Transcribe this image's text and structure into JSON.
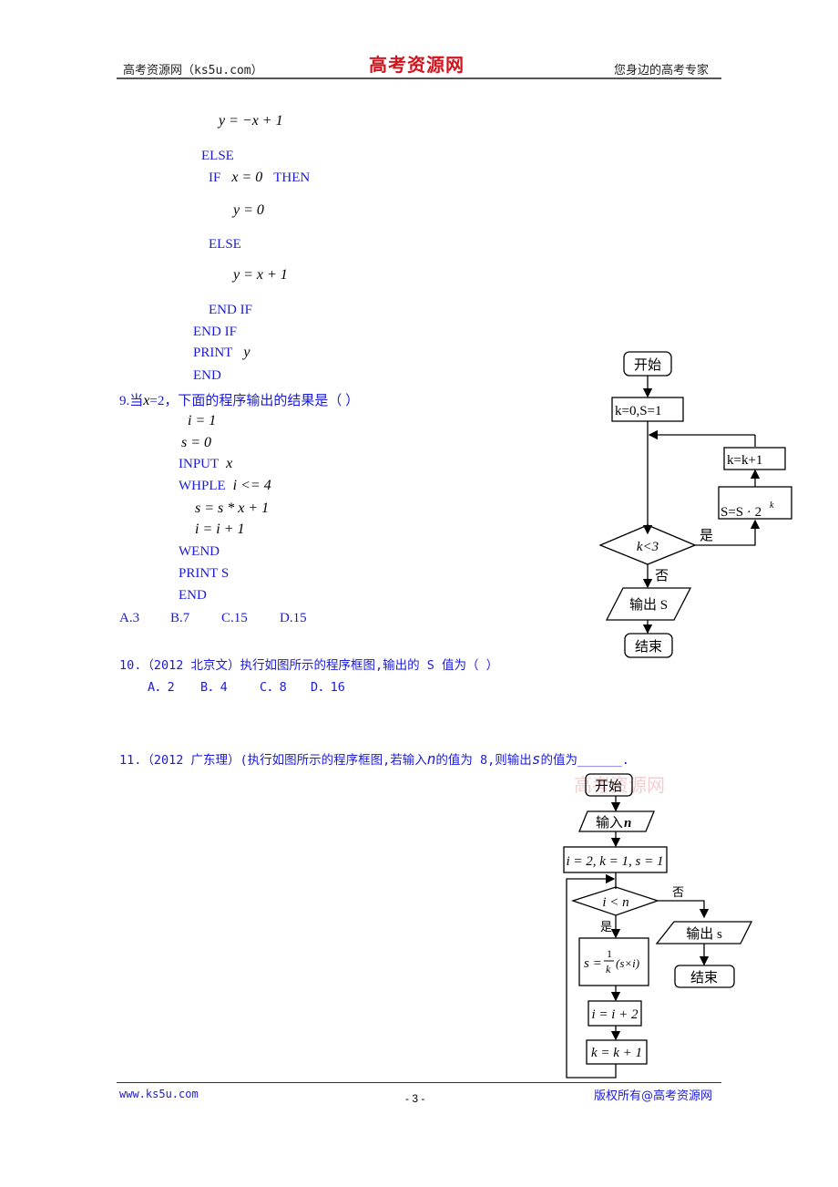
{
  "header": {
    "left": "高考资源网（ks5u.com）",
    "center_logo": "高考资源网",
    "right": "您身边的高考专家"
  },
  "program8": {
    "lines": [
      {
        "type": "math",
        "text": "y = −x + 1"
      },
      {
        "type": "kw",
        "text": "ELSE"
      },
      {
        "type": "mixed",
        "kw1": "IF",
        "math": "x = 0",
        "kw2": "THEN"
      },
      {
        "type": "math",
        "text": "y = 0"
      },
      {
        "type": "kw",
        "text": "ELSE"
      },
      {
        "type": "math",
        "text": "y = x + 1"
      },
      {
        "type": "kw",
        "text": "END IF"
      },
      {
        "type": "kw",
        "text": "END IF"
      },
      {
        "type": "mixed",
        "kw1": "PRINT",
        "math": "y"
      },
      {
        "type": "kw",
        "text": "END"
      }
    ]
  },
  "question9": {
    "stem_prefix": "9.当",
    "stem_var": "x",
    "stem_suffix": "=2，下面的程序输出的结果是（  ）",
    "code": {
      "l1": "i = 1",
      "l2": "s = 0",
      "l3_kw": "INPUT",
      "l3_var": "x",
      "l4_kw": "WHPLE",
      "l4_cond": "i <= 4",
      "l5": "s = s * x + 1",
      "l6": "i = i + 1",
      "l7": "WEND",
      "l8": "PRINT S",
      "l9": "END"
    },
    "options": [
      "A.3",
      "B.7",
      "C.15",
      "D.15"
    ]
  },
  "question10": {
    "stem": "10.（2012 北京文）执行如图所示的程序框图,输出的 S 值为（        ）",
    "options": [
      "A．2",
      "B．4",
      "C．8",
      "D．16"
    ],
    "flowchart": {
      "start": "开始",
      "init": "k=0,S=1",
      "cond": "k<3",
      "yes": "是",
      "no": "否",
      "update_s": "S=S · 2",
      "update_s_exp": "k",
      "update_k": "k=k+1",
      "output": "输出 S",
      "end": "结束"
    }
  },
  "question11": {
    "stem_a": "11.（2012 广东理）(执行如图所示的程序框图,若输入",
    "var_n": "n",
    "stem_b": "的值为 8,则输出",
    "var_s": "s",
    "stem_c": "的值为______.",
    "flowchart": {
      "watermark": "高考资源网",
      "start": "开始",
      "input": "输入",
      "input_var": "n",
      "init": "i = 2, k = 1, s = 1",
      "cond": "i < n",
      "yes": "是",
      "no": "否",
      "compute_lhs": "s =",
      "compute_num": "1",
      "compute_den": "k",
      "compute_rhs": "(s×i)",
      "inc_i": "i = i + 2",
      "inc_k": "k = k + 1",
      "output": "输出 s",
      "end": "结束"
    }
  },
  "footer": {
    "left": "www.ks5u.com",
    "center": "- 3 -",
    "right": "版权所有@高考资源网"
  }
}
